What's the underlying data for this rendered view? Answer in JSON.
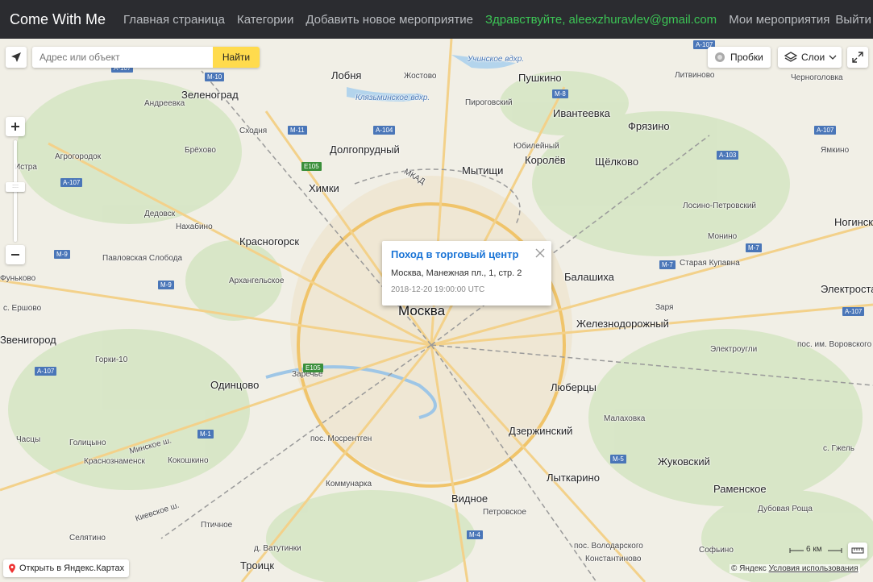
{
  "navbar": {
    "brand": "Come With Me",
    "links": [
      "Главная страница",
      "Категории",
      "Добавить новое мероприятие"
    ],
    "greeting": "Здравствуйте, aleexzhuravlev@gmail.com",
    "my_events": "Мои мероприятия",
    "logout": "Выйти"
  },
  "map_controls": {
    "search_placeholder": "Адрес или объект",
    "search_button": "Найти",
    "traffic": "Пробки",
    "layers": "Слои",
    "open_in_yandex": "Открыть в Яндекс.Картах",
    "scale": "6 км",
    "copyright_brand": "© Яндекс",
    "terms": "Условия использования"
  },
  "popup": {
    "title": "Поход в торговый центр",
    "address": "Москва, Манежная пл., 1, стр. 2",
    "datetime": "2018-12-20 19:00:00 UTC"
  },
  "map_labels": {
    "big": [
      "Москва"
    ],
    "cities": [
      "Лобня",
      "Пушкино",
      "Зеленоград",
      "Ивантеевка",
      "Фрязино",
      "Долгопрудный",
      "Королёв",
      "Щёлково",
      "Мытищи",
      "Химки",
      "Красногорск",
      "Балашиха",
      "Железнодорожный",
      "Одинцово",
      "Люберцы",
      "Дзержинский",
      "Лыткарино",
      "Жуковский",
      "Раменское",
      "Видное",
      "Троицк",
      "Ногинск",
      "Электросталь",
      "Звенигород"
    ],
    "towns": [
      "Андреевка",
      "Сходня",
      "Жостово",
      "Пироговский",
      "Литвиново",
      "Черноголовка",
      "Юбилейный",
      "Брёхово",
      "Агрогородок",
      "Истра",
      "Дедовск",
      "Нахабино",
      "Павловская Слобода",
      "Архангельское",
      "Фуньково",
      "с. Ершово",
      "Горки-10",
      "Заречье",
      "Голицыно",
      "Часцы",
      "Краснознаменск",
      "Кокошкино",
      "пос. Мосрентген",
      "Коммунарка",
      "Петровское",
      "Птичное",
      "Селятино",
      "д. Ватутинки",
      "пос. Володарского",
      "Константиново",
      "Софьино",
      "Дубовая Роща",
      "Малаховка",
      "Заря",
      "Электроугли",
      "Старая Купавна",
      "Монино",
      "Лосино-Петровский",
      "Ямкино",
      "пос. им. Воровского",
      "с. Гжель",
      "Минское ш.",
      "Киевское ш.",
      "МКАД"
    ],
    "water": [
      "Учинское вдхр.",
      "Клязьминское вдхр."
    ],
    "roads": [
      "M-10",
      "A-104",
      "M-11",
      "E105",
      "M-8",
      "A-107",
      "A-103",
      "M-7",
      "M-9",
      "M-1",
      "M-5",
      "M-4",
      "A-107",
      "A-107",
      "A-107",
      "A-107",
      "E105",
      "M-9",
      "M-7",
      "A-107"
    ]
  }
}
